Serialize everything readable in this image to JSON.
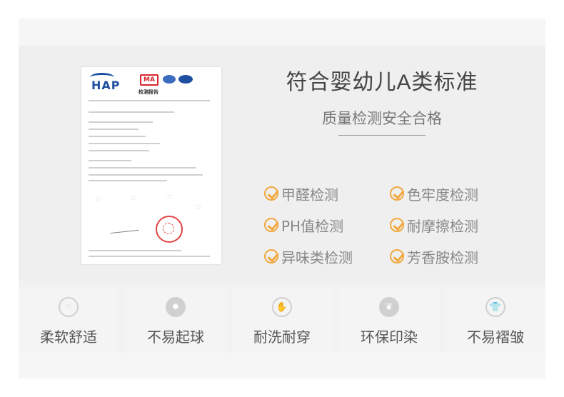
{
  "hero": {
    "title": "符合婴幼儿A类标准",
    "subtitle": "质量检测安全合格"
  },
  "certificate": {
    "logo": "HAP",
    "heading": "检测报告"
  },
  "tests": [
    {
      "label": "甲醛检测"
    },
    {
      "label": "色牢度检测"
    },
    {
      "label": "PH值检测"
    },
    {
      "label": "耐摩擦检测"
    },
    {
      "label": "异味类检测"
    },
    {
      "label": "芳香胺检测"
    }
  ],
  "features": [
    {
      "label": "柔软舒适",
      "icon": "soft-dots-icon"
    },
    {
      "label": "不易起球",
      "icon": "pilling-icon"
    },
    {
      "label": "耐洗耐穿",
      "icon": "glove-icon"
    },
    {
      "label": "环保印染",
      "icon": "leaf-icon"
    },
    {
      "label": "不易褶皱",
      "icon": "shirt-icon"
    }
  ],
  "colors": {
    "accent": "#f2a83d",
    "text_dark": "#444444",
    "text_muted": "#888888",
    "background": "#efefef"
  }
}
